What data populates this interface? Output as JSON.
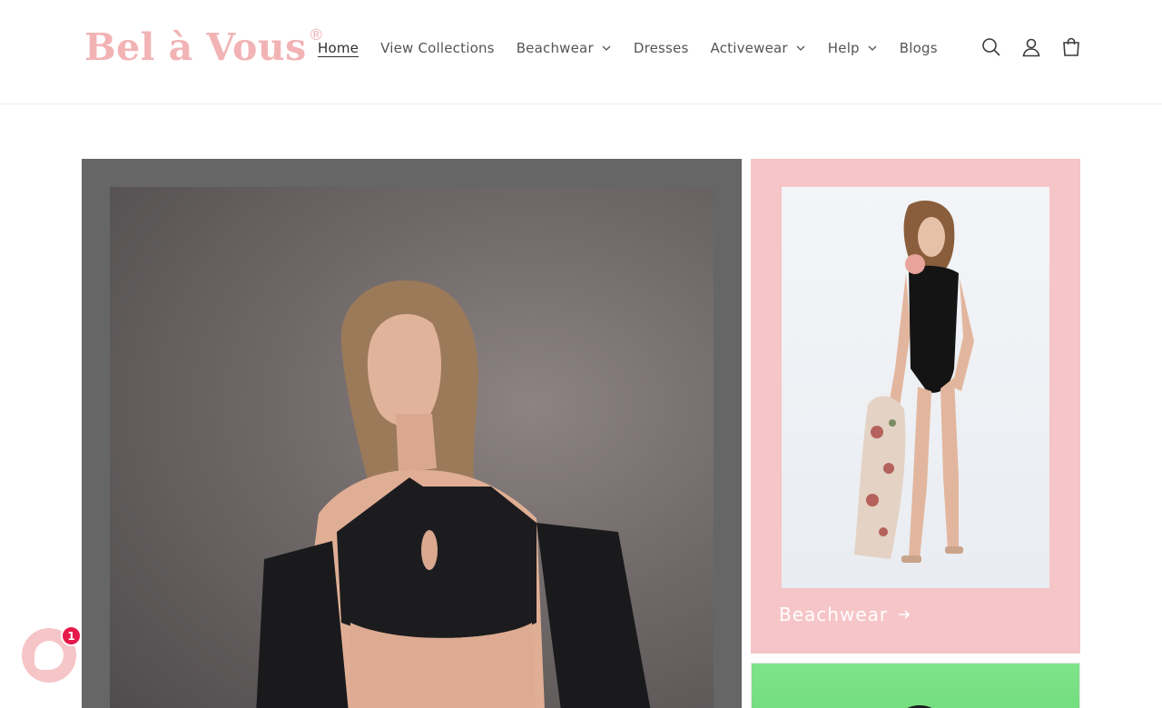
{
  "brand": {
    "logo_text": "Bel à Vous",
    "logo_reg": "®",
    "logo_color": "#f2b3b5"
  },
  "nav": {
    "items": [
      {
        "label": "Home",
        "active": true,
        "has_dropdown": false
      },
      {
        "label": "View Collections",
        "active": false,
        "has_dropdown": false
      },
      {
        "label": "Beachwear",
        "active": false,
        "has_dropdown": true
      },
      {
        "label": "Dresses",
        "active": false,
        "has_dropdown": false
      },
      {
        "label": "Activewear",
        "active": false,
        "has_dropdown": true
      },
      {
        "label": "Help",
        "active": false,
        "has_dropdown": true
      },
      {
        "label": "Blogs",
        "active": false,
        "has_dropdown": false
      }
    ]
  },
  "header_icons": [
    "search-icon",
    "account-icon",
    "cart-icon"
  ],
  "collections": {
    "main_tile": {
      "bg_color": "#666666"
    },
    "beachwear_tile": {
      "label": "Beachwear",
      "bg_color": "#f6c5c7"
    },
    "activewear_tile": {
      "bg_color": "#7fe38a"
    }
  },
  "chat": {
    "badge_count": "1",
    "bg_color": "#f6c5c7",
    "badge_color": "#e6194b"
  }
}
